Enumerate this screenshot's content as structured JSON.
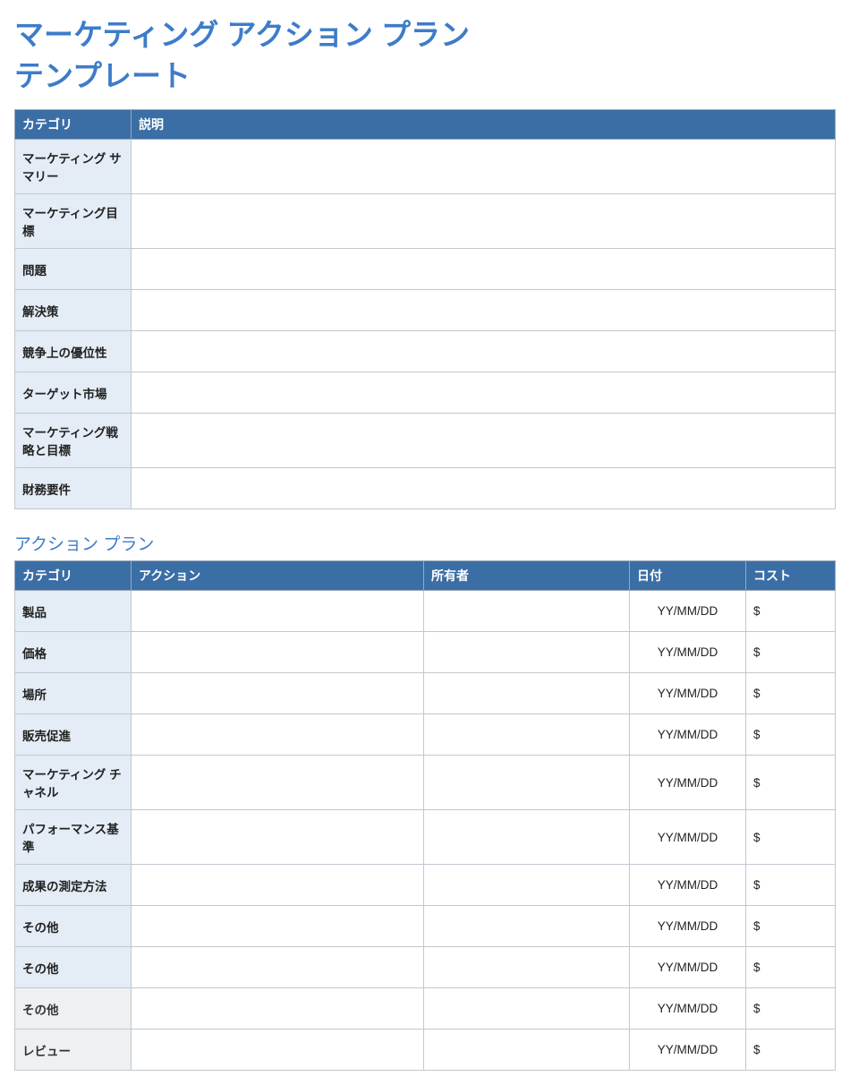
{
  "title": "マーケティング アクション プラン テンプレート",
  "table1": {
    "headers": {
      "category": "カテゴリ",
      "description": "説明"
    },
    "rows": [
      {
        "category": "マーケティング サマリー",
        "description": ""
      },
      {
        "category": "マーケティング目標",
        "description": ""
      },
      {
        "category": "問題",
        "description": ""
      },
      {
        "category": "解決策",
        "description": ""
      },
      {
        "category": "競争上の優位性",
        "description": ""
      },
      {
        "category": "ターゲット市場",
        "description": ""
      },
      {
        "category": "マーケティング戦略と目標",
        "description": ""
      },
      {
        "category": "財務要件",
        "description": ""
      }
    ]
  },
  "section2_title": "アクション プラン",
  "table2": {
    "headers": {
      "category": "カテゴリ",
      "action": "アクション",
      "owner": "所有者",
      "date": "日付",
      "cost": "コスト"
    },
    "rows": [
      {
        "category": "製品",
        "action": "",
        "owner": "",
        "date": "YY/MM/DD",
        "cost": "$",
        "alt": false
      },
      {
        "category": "価格",
        "action": "",
        "owner": "",
        "date": "YY/MM/DD",
        "cost": "$",
        "alt": false
      },
      {
        "category": "場所",
        "action": "",
        "owner": "",
        "date": "YY/MM/DD",
        "cost": "$",
        "alt": false
      },
      {
        "category": "販売促進",
        "action": "",
        "owner": "",
        "date": "YY/MM/DD",
        "cost": "$",
        "alt": false
      },
      {
        "category": "マーケティング チャネル",
        "action": "",
        "owner": "",
        "date": "YY/MM/DD",
        "cost": "$",
        "alt": false
      },
      {
        "category": "パフォーマンス基準",
        "action": "",
        "owner": "",
        "date": "YY/MM/DD",
        "cost": "$",
        "alt": false
      },
      {
        "category": "成果の測定方法",
        "action": "",
        "owner": "",
        "date": "YY/MM/DD",
        "cost": "$",
        "alt": false
      },
      {
        "category": "その他",
        "action": "",
        "owner": "",
        "date": "YY/MM/DD",
        "cost": "$",
        "alt": false
      },
      {
        "category": "その他",
        "action": "",
        "owner": "",
        "date": "YY/MM/DD",
        "cost": "$",
        "alt": false
      },
      {
        "category": "その他",
        "action": "",
        "owner": "",
        "date": "YY/MM/DD",
        "cost": "$",
        "alt": true
      },
      {
        "category": "レビュー",
        "action": "",
        "owner": "",
        "date": "YY/MM/DD",
        "cost": "$",
        "alt": true
      }
    ]
  }
}
